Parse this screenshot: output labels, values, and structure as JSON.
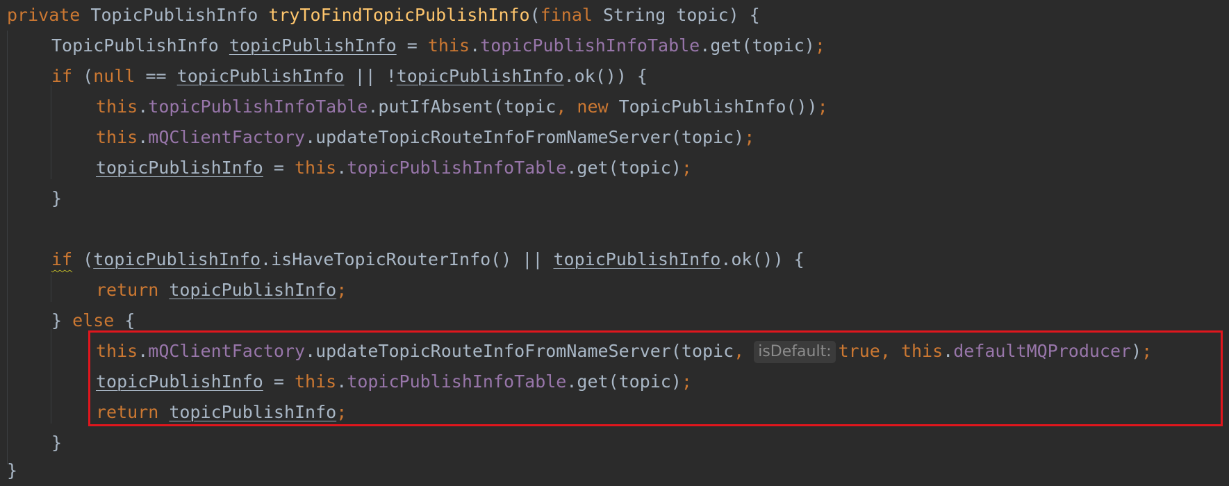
{
  "code": {
    "line1": {
      "kw_private": "private",
      "ret_type": "TopicPublishInfo",
      "method_name": "tryToFindTopicPublishInfo",
      "open_paren": "(",
      "kw_final": "final",
      "param_type": "String",
      "param_name": "topic",
      "close": ") {"
    },
    "line2": {
      "type": "TopicPublishInfo",
      "var": "topicPublishInfo",
      "eq": " = ",
      "kw_this": "this",
      "dot": ".",
      "field": "topicPublishInfoTable",
      "call": ".get(topic)",
      "semi": ";"
    },
    "line3": {
      "kw_if": "if",
      "open": " (",
      "kw_null": "null",
      "op": " == ",
      "var1": "topicPublishInfo",
      "or": " || !",
      "var2": "topicPublishInfo",
      "rest": ".ok()) {"
    },
    "line4": {
      "kw_this": "this",
      "dot": ".",
      "field": "topicPublishInfoTable",
      "call": ".putIfAbsent(topic",
      "comma": ",",
      "kw_new": " new",
      "rest": " TopicPublishInfo())",
      "semi": ";"
    },
    "line5": {
      "kw_this": "this",
      "dot": ".",
      "field": "mQClientFactory",
      "call": ".updateTopicRouteInfoFromNameServer(topic)",
      "semi": ";"
    },
    "line6": {
      "var": "topicPublishInfo",
      "eq": " = ",
      "kw_this": "this",
      "dot": ".",
      "field": "topicPublishInfoTable",
      "call": ".get(topic)",
      "semi": ";"
    },
    "line7": {
      "brace": "}"
    },
    "line9": {
      "kw_if": "if",
      "open": " (",
      "var1": "topicPublishInfo",
      "call1": ".isHaveTopicRouterInfo() || ",
      "var2": "topicPublishInfo",
      "rest": ".ok()) {"
    },
    "line10": {
      "kw_return": "return",
      "var": "topicPublishInfo",
      "semi": ";"
    },
    "line11": {
      "brace": "} ",
      "kw_else": "else",
      "open": " {"
    },
    "line12": {
      "kw_this": "this",
      "dot": ".",
      "field": "mQClientFactory",
      "call": ".updateTopicRouteInfoFromNameServer(topic",
      "comma": ",",
      "hint": "isDefault:",
      "kw_true": "true",
      "comma2": ",",
      "kw_this2": " this",
      "dot2": ".",
      "field2": "defaultMQProducer",
      "close": ")",
      "semi": ";"
    },
    "line13": {
      "var": "topicPublishInfo",
      "eq": " = ",
      "kw_this": "this",
      "dot": ".",
      "field": "topicPublishInfoTable",
      "call": ".get(topic)",
      "semi": ";"
    },
    "line14": {
      "kw_return": "return",
      "var": "topicPublishInfo",
      "semi": ";"
    },
    "line15": {
      "brace": "}"
    },
    "line16": {
      "brace": "}"
    }
  },
  "colors": {
    "background": "#2b2b2b",
    "keyword": "#cc7832",
    "method_declaration": "#ffc66d",
    "field": "#9876aa",
    "default_text": "#a9b7c6",
    "highlight_box": "#e0161d"
  }
}
